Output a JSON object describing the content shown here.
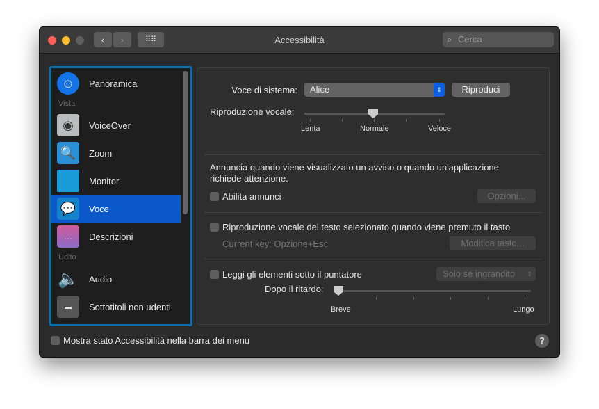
{
  "window": {
    "title": "Accessibilità",
    "search_placeholder": "Cerca"
  },
  "sidebar": {
    "items": [
      {
        "label": "Panoramica",
        "icon": "accessibility-icon"
      },
      {
        "section": "Vista"
      },
      {
        "label": "VoiceOver",
        "icon": "voiceover-icon"
      },
      {
        "label": "Zoom",
        "icon": "zoom-icon"
      },
      {
        "label": "Monitor",
        "icon": "monitor-icon"
      },
      {
        "label": "Voce",
        "icon": "speech-icon",
        "selected": true
      },
      {
        "label": "Descrizioni",
        "icon": "descriptions-icon"
      },
      {
        "section": "Udito"
      },
      {
        "label": "Audio",
        "icon": "speaker-icon"
      },
      {
        "label": "Sottotitoli non udenti",
        "icon": "captions-icon"
      }
    ]
  },
  "main": {
    "system_voice_label": "Voce di sistema:",
    "system_voice_value": "Alice",
    "play_button": "Riproduci",
    "rate_label": "Riproduzione vocale:",
    "rate_min": "Lenta",
    "rate_mid": "Normale",
    "rate_max": "Veloce",
    "rate_value": 0.5,
    "announce_text": "Annuncia quando viene visualizzato un avviso o quando un'applicazione richiede attenzione.",
    "enable_announce": "Abilita annunci",
    "options_button": "Opzioni...",
    "speak_selected": "Riproduzione vocale del testo selezionato quando viene premuto il tasto",
    "current_key": "Current key: Opzione+Esc",
    "change_key_button": "Modifica tasto...",
    "speak_pointer": "Leggi gli elementi sotto il puntatore",
    "pointer_mode": "Solo se ingrandito",
    "delay_label": "Dopo il ritardo:",
    "delay_min": "Breve",
    "delay_max": "Lungo",
    "delay_value": 0
  },
  "footer": {
    "show_status": "Mostra stato Accessibilità nella barra dei menu",
    "help": "?"
  },
  "colors": {
    "accent": "#0a58ca",
    "focus": "#0a6fb0"
  }
}
